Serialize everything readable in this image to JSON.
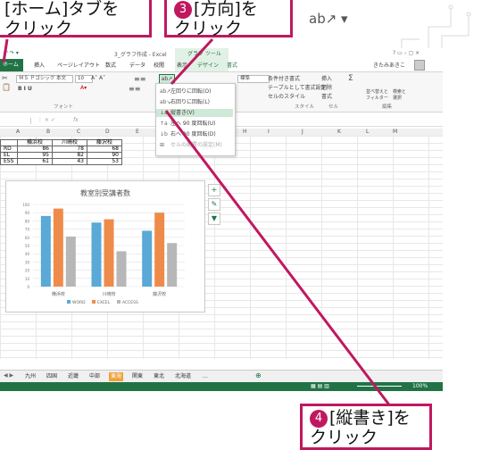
{
  "callouts": {
    "c1_text": "[ホーム]タブを\nクリック",
    "c3_num": "3",
    "c3_text": "[方向]を\nクリック",
    "c4_num": "4",
    "c4_text": "[縦書き]を\nクリック"
  },
  "title": {
    "window": "3_グラフ作成 - Excel",
    "context_tool": "グラフ ツール",
    "user": "きたみあきこ"
  },
  "tabs": [
    "ホーム",
    "挿入",
    "ページレイアウト",
    "数式",
    "データ",
    "校閲",
    "表示",
    "デザイン",
    "書式"
  ],
  "ribbon": {
    "font_name": "ＭＳ Ｐゴシック 本文",
    "font_size": "10",
    "font_buttons": "B  I  U",
    "group_font": "フォント",
    "group_style": "スタイル",
    "group_cells": "セル",
    "group_edit": "編集",
    "number_format": "標準",
    "cond_format": "条件付き書式",
    "table_format": "テーブルとして書式設定",
    "cell_style": "セルのスタイル",
    "insert": "挿入",
    "delete": "削除",
    "format": "書式",
    "sort_filter": "並べ替えと\nフィルター",
    "find_select": "検索と\n選択"
  },
  "orientation_menu": [
    {
      "icon": "ab↗",
      "label": "左回りに回転(O)",
      "state": "normal"
    },
    {
      "icon": "ab↘",
      "label": "右回りに回転(L)",
      "state": "normal"
    },
    {
      "icon": "↓a",
      "label": "縦書き(V)",
      "state": "highlight"
    },
    {
      "icon": "↑a",
      "label": "左へ 90 度回転(U)",
      "state": "normal"
    },
    {
      "icon": "↓b",
      "label": "右へ 90 度回転(D)",
      "state": "normal"
    },
    {
      "icon": "⊞",
      "label": "セルの配置の設定(M)",
      "state": "disabled"
    }
  ],
  "orientation_button_glyph": "ab↗ ▾",
  "formula_bar": {
    "namebox": "",
    "fx": "fx"
  },
  "columns": [
    "A",
    "B",
    "C",
    "D",
    "E",
    "F",
    "G",
    "H",
    "I",
    "J",
    "K",
    "L",
    "M"
  ],
  "table": {
    "headers": [
      "",
      "横浜校",
      "川崎校",
      "藤沢校"
    ],
    "rows": [
      [
        "RD",
        "86",
        "78",
        "68"
      ],
      [
        "EL",
        "95",
        "82",
        "90"
      ],
      [
        "ESS",
        "61",
        "43",
        "53"
      ]
    ]
  },
  "colors": {
    "excel_green": "#217346",
    "callout_pink": "#c0185f",
    "word": "#5aa9d6",
    "excel": "#ef8b4a",
    "access": "#b7b7b7"
  },
  "chart_data": {
    "type": "bar",
    "title": "教室別受講者数",
    "categories": [
      "横浜校",
      "川崎校",
      "藤沢校"
    ],
    "series": [
      {
        "name": "WORD",
        "values": [
          86,
          78,
          68
        ]
      },
      {
        "name": "EXCEL",
        "values": [
          95,
          82,
          90
        ]
      },
      {
        "name": "ACCESS",
        "values": [
          61,
          43,
          53
        ]
      }
    ],
    "ylim": [
      0,
      100
    ],
    "yticks": [
      "0",
      "10",
      "20",
      "30",
      "40",
      "50",
      "60",
      "70",
      "80",
      "90",
      "100"
    ],
    "grid": true,
    "legend": "bottom"
  },
  "chart_side_buttons": [
    "+",
    "✎",
    "▼"
  ],
  "sheets": [
    "九州",
    "四国",
    "近畿",
    "中部",
    "東海",
    "関東",
    "東北",
    "北海道",
    "..."
  ],
  "status": {
    "zoom": "100%"
  }
}
